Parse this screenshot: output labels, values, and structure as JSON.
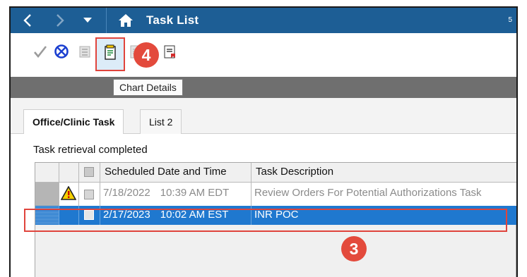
{
  "titlebar": {
    "title": "Task List",
    "right_text": "5",
    "icons": [
      "back-arrow-icon",
      "forward-arrow-icon",
      "dropdown-icon",
      "home-icon"
    ],
    "color": "#1d5e95"
  },
  "toolbar": {
    "icons": [
      "checkmark-icon",
      "cancel-circle-icon",
      "print-icon",
      "chart-details-icon",
      "document-icon",
      "flag-document-icon"
    ],
    "tooltip": "Chart Details",
    "highlight_color": "#e0443c"
  },
  "callouts": {
    "step4": "4",
    "step3": "3"
  },
  "tabs": [
    {
      "label": "Office/Clinic Task",
      "active": true
    },
    {
      "label": "List 2",
      "active": false
    }
  ],
  "status": "Task retrieval completed",
  "grid": {
    "columns": [
      "",
      "",
      "",
      "Scheduled Date and Time",
      "Task Description"
    ],
    "rows": [
      {
        "date": "7/18/2022",
        "time": "10:39 AM EDT",
        "description": "Review Orders For Potential Authorizations Task",
        "alert_icon": "warning-icon",
        "selected": false
      },
      {
        "date": "2/17/2023",
        "time": "10:02 AM EST",
        "description": "INR POC",
        "alert_icon": "",
        "selected": true
      }
    ],
    "selected_color": "#1f78cf"
  }
}
